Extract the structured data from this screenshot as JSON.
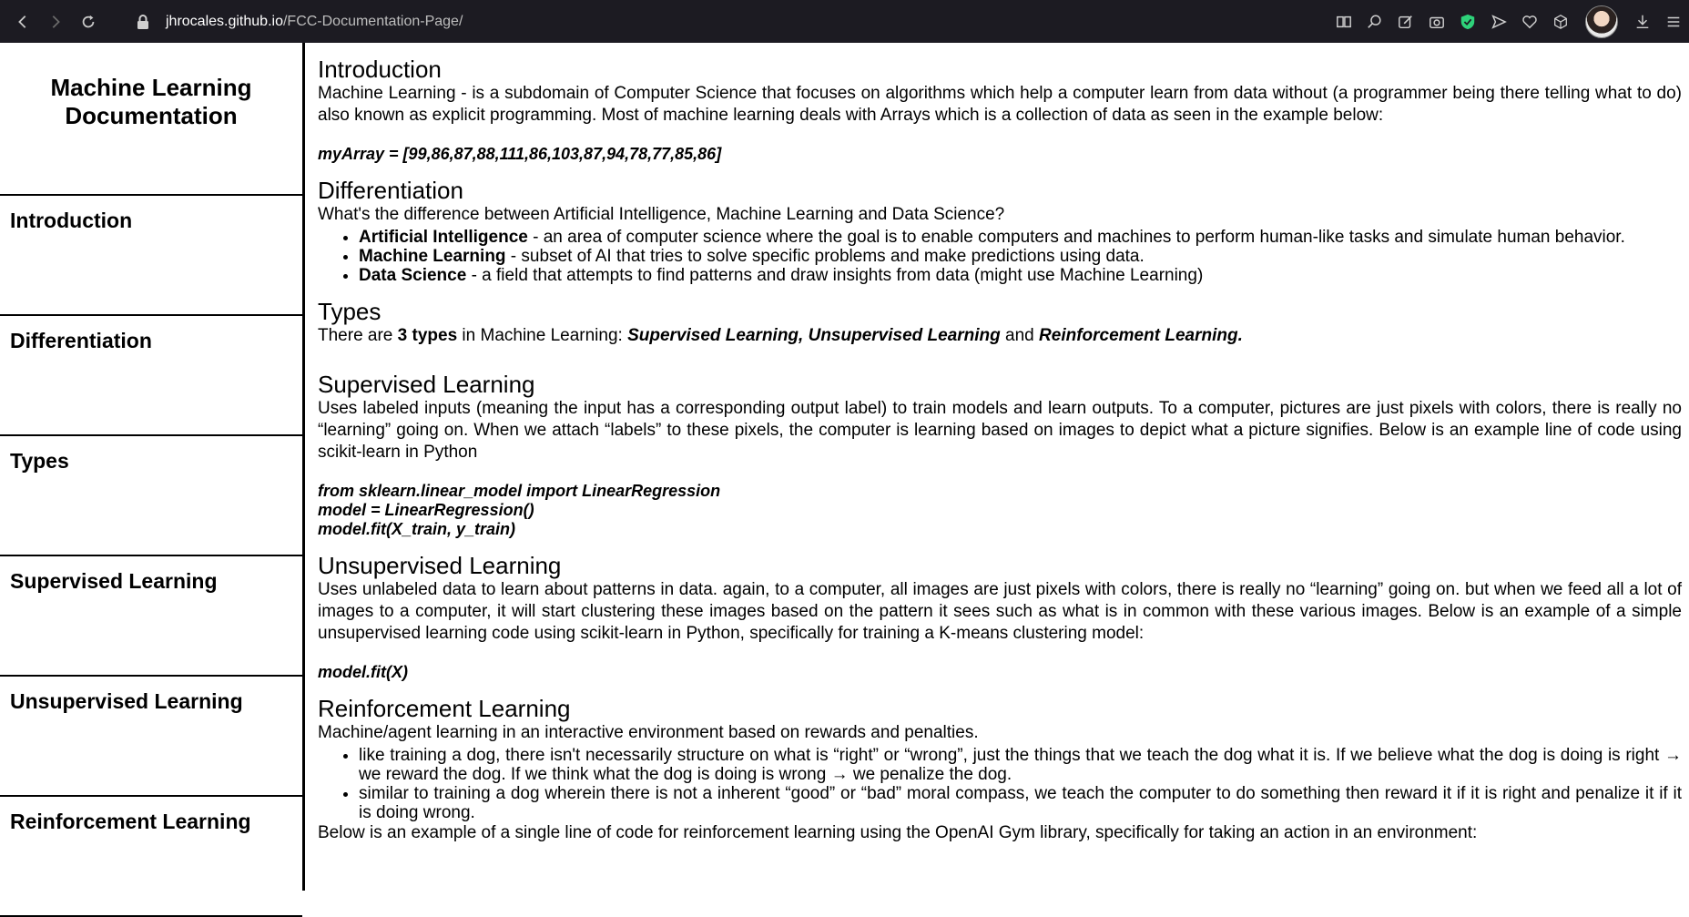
{
  "browser": {
    "url_host": "jhrocales.github.io",
    "url_path": "/FCC-Documentation-Page/"
  },
  "navbar": {
    "title": "Machine Learning Documentation",
    "links": [
      "Introduction",
      "Differentiation",
      "Types",
      "Supervised Learning",
      "Unsupervised Learning",
      "Reinforcement Learning"
    ]
  },
  "sections": {
    "intro": {
      "title": "Introduction",
      "text": "Machine Learning - is a subdomain of Computer Science that focuses on algorithms which help a computer learn from data without (a programmer being there telling what to do) also known as explicit programming. Most of machine learning deals with Arrays which is a collection of data as seen in the example below:",
      "code": "myArray = [99,86,87,88,111,86,103,87,94,78,77,85,86]"
    },
    "diff": {
      "title": "Differentiation",
      "text": "What's the difference between Artificial Intelligence, Machine Learning and Data Science?",
      "items": [
        {
          "term": "Artificial Intelligence",
          "desc": " - an area of computer science where the goal is to enable computers and machines to perform human-like tasks and simulate human behavior."
        },
        {
          "term": "Machine Learning",
          "desc": " - subset of AI that tries to solve specific problems and make predictions using data."
        },
        {
          "term": "Data Science",
          "desc": " - a field that attempts to find patterns and draw insights from data (might use Machine Learning)"
        }
      ]
    },
    "types": {
      "title": "Types",
      "pre": "There are ",
      "count": "3 types",
      "mid": " in Machine Learning: ",
      "list": "Supervised Learning, Unsupervised Learning",
      "and": " and ",
      "last": "Reinforcement Learning."
    },
    "supervised": {
      "title": "Supervised Learning",
      "text": "Uses labeled inputs (meaning the input has a corresponding output label) to train models and learn outputs. To a computer, pictures are just pixels with colors, there is really no “learning” going on. When we attach “labels” to these pixels, the computer is learning based on images to depict what a picture signifies. Below is an example line of code using scikit-learn in Python",
      "code": [
        "from sklearn.linear_model import LinearRegression",
        "model = LinearRegression()",
        "model.fit(X_train, y_train)"
      ]
    },
    "unsupervised": {
      "title": "Unsupervised Learning",
      "text": "Uses unlabeled data to learn about patterns in data. again, to a computer, all images are just pixels with colors, there is really no “learning” going on. but when we feed all a lot of images to a computer, it will start clustering these images based on the pattern it sees such as what is in common with these various images. Below is an example of a simple unsupervised learning code using scikit-learn in Python, specifically for training a K-means clustering model:",
      "code": "model.fit(X)"
    },
    "reinforcement": {
      "title": "Reinforcement Learning",
      "text": "Machine/agent learning in an interactive environment based on rewards and penalties.",
      "items": [
        "like training a dog, there isn't necessarily structure on what is “right” or “wrong”, just the things that we teach the dog what it is. If we believe what the dog is doing is right → we reward the dog. If we think what the dog is doing is wrong → we penalize the dog.",
        "similar to training a dog wherein there is not a inherent “good” or “bad” moral compass, we teach the computer to do something then reward it if it is right and penalize it if it is doing wrong."
      ],
      "after": "Below is an example of a single line of code for reinforcement learning using the OpenAI Gym library, specifically for taking an action in an environment:"
    }
  },
  "icons": {
    "toolbar_right": [
      "reader-icon",
      "zoom-icon",
      "edit-icon",
      "camera-icon",
      "shield-icon",
      "send-icon",
      "heart-icon",
      "cube-icon",
      "avatar",
      "download-icon",
      "menu-icon"
    ]
  }
}
